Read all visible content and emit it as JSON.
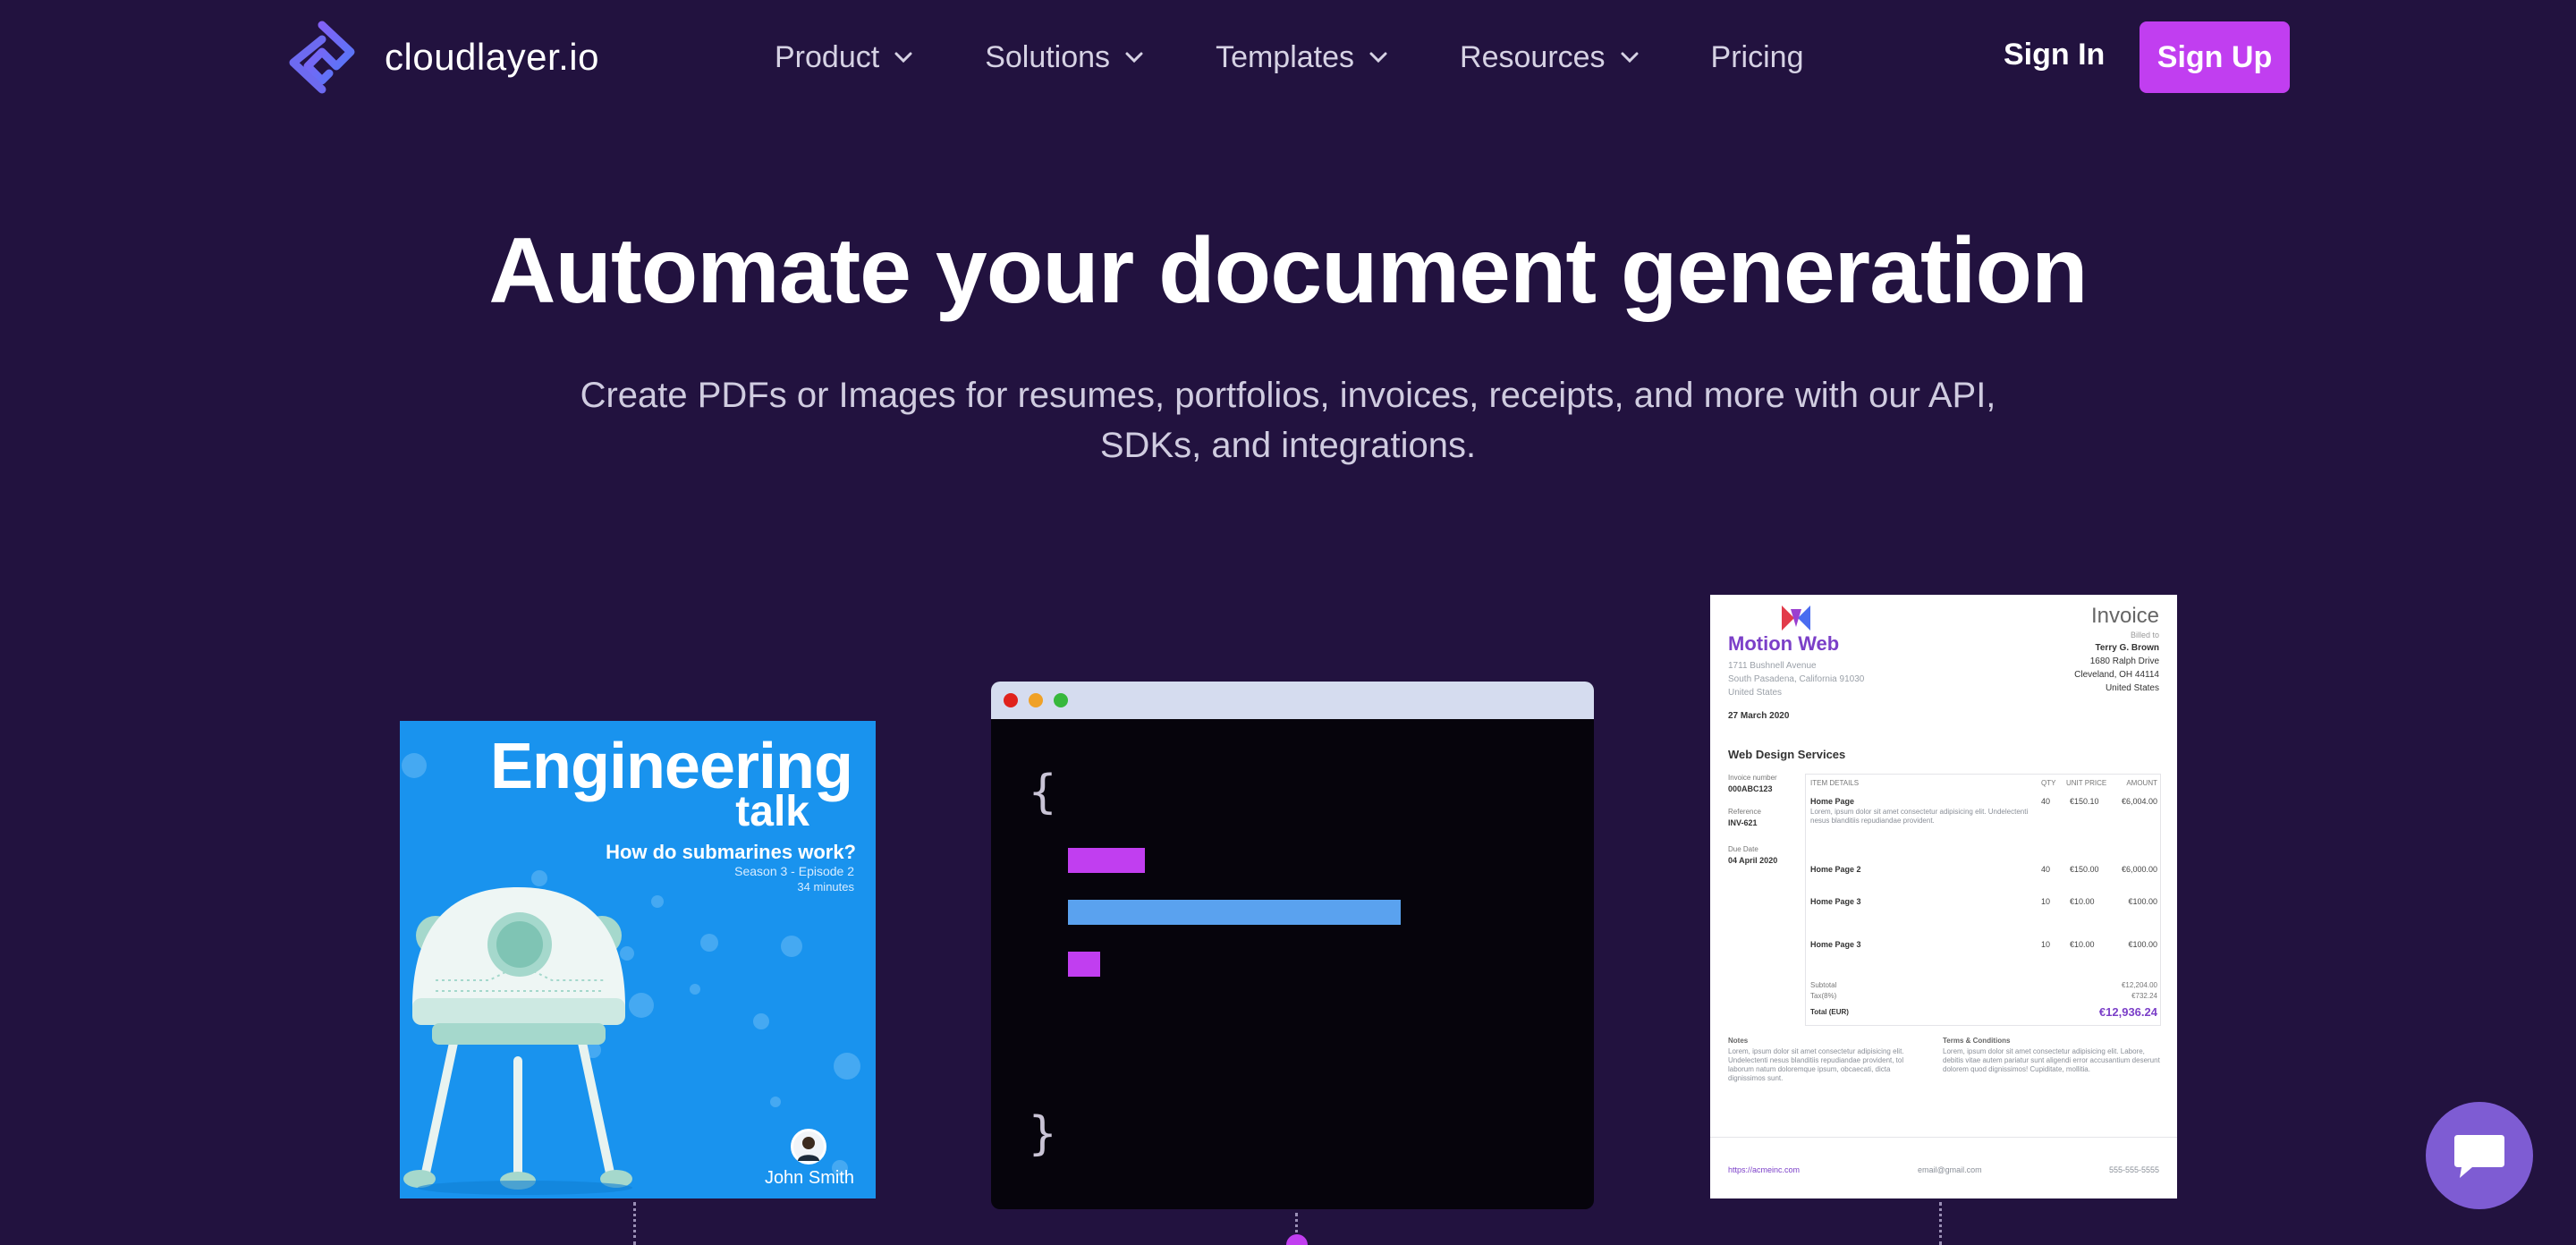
{
  "nav": {
    "brand": "cloudlayer.io",
    "menu": [
      {
        "label": "Product",
        "has_dropdown": true
      },
      {
        "label": "Solutions",
        "has_dropdown": true
      },
      {
        "label": "Templates",
        "has_dropdown": true
      },
      {
        "label": "Resources",
        "has_dropdown": true
      },
      {
        "label": "Pricing",
        "has_dropdown": false
      }
    ],
    "sign_in": "Sign In",
    "sign_up": "Sign Up"
  },
  "hero": {
    "title": "Automate your document generation",
    "subtitle": "Create PDFs or Images for resumes, portfolios, invoices, receipts, and more with our API, SDKs, and integrations."
  },
  "podcast_card": {
    "title_line1": "Engineering",
    "title_line2": "talk",
    "question": "How do submarines work?",
    "season": "Season 3 - Episode 2",
    "duration": "34 minutes",
    "host": "John Smith"
  },
  "code_card": {
    "open_brace": "{",
    "close_brace": "}"
  },
  "invoice_card": {
    "heading": "Invoice",
    "company": "Motion Web",
    "address": [
      "1711 Bushnell Avenue",
      "South Pasadena, California 91030",
      "United States"
    ],
    "date": "27 March 2020",
    "billed_to_label": "Billed to",
    "billed_to": [
      "Terry G. Brown",
      "1680 Ralph Drive",
      "Cleveland, OH 44114",
      "United States"
    ],
    "section_title": "Web Design Services",
    "meta": [
      {
        "label": "Invoice number",
        "value": "000ABC123"
      },
      {
        "label": "Reference",
        "value": "INV-621"
      },
      {
        "label": "Due Date",
        "value": "04 April 2020"
      }
    ],
    "columns": [
      "ITEM DETAILS",
      "QTY",
      "UNIT PRICE",
      "AMOUNT"
    ],
    "items": [
      {
        "name": "Home Page",
        "qty": "40",
        "unit": "€150.10",
        "amount": "€6,004.00"
      },
      {
        "name": "Home Page 2",
        "qty": "40",
        "unit": "€150.00",
        "amount": "€6,000.00"
      },
      {
        "name": "Home Page 3",
        "qty": "10",
        "unit": "€10.00",
        "amount": "€100.00"
      },
      {
        "name": "Home Page 3",
        "qty": "10",
        "unit": "€10.00",
        "amount": "€100.00"
      }
    ],
    "item_desc": "Lorem, ipsum dolor sit amet consectetur adipisicing elit. Undelectenti nesus blanditiis repudiandae provident.",
    "subtotal_label": "Subtotal",
    "subtotal": "€12,204.00",
    "tax_label": "Tax(8%)",
    "tax": "€732.24",
    "total_label": "Total (EUR)",
    "total": "€12,936.24",
    "notes_label": "Notes",
    "terms_label": "Terms & Conditions",
    "notes_text": "Lorem, ipsum dolor sit amet consectetur adipisicing elit. Undelectenti nesus blanditiis repudiandae provident, tol laborum natum doloremque ipsum, obcaecati, dicta dignissimos sunt.",
    "terms_text": "Lorem, ipsum dolor sit amet consectetur adipisicing elit. Labore, debitis vitae autem pariatur sunt aligendi error accusantium deserunt dolorem quod dignissimos! Cupiditate, mollitia.",
    "footer_url": "https://acmeinc.com",
    "footer_email": "email@gmail.com",
    "footer_phone": "555-555-5555"
  },
  "colors": {
    "background": "#22123f",
    "accent": "#c13ef0",
    "code_pink": "#c13ef0",
    "code_blue": "#5aa2ef",
    "chat": "#7e5cd3"
  }
}
